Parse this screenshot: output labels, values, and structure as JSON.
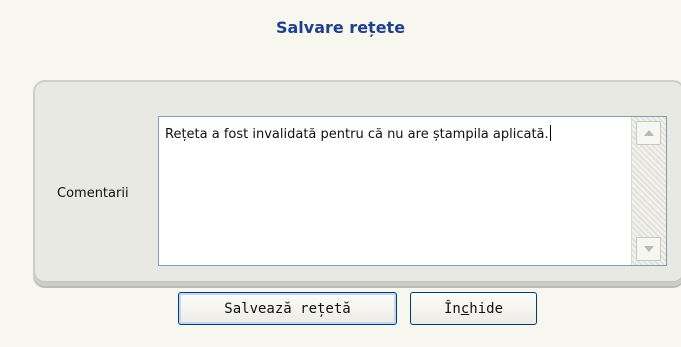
{
  "dialog": {
    "title": "Salvare rețete",
    "comment_label": "Comentarii",
    "comment_text": "Rețeta a fost invalidată pentru că nu are ștampila aplicată."
  },
  "buttons": {
    "save_label": "Salvează rețetă",
    "close_prefix": "În",
    "close_underlined": "c",
    "close_suffix": "hide"
  },
  "icons": {
    "scroll_up": "scroll-up-arrow-icon",
    "scroll_down": "scroll-down-arrow-icon"
  }
}
